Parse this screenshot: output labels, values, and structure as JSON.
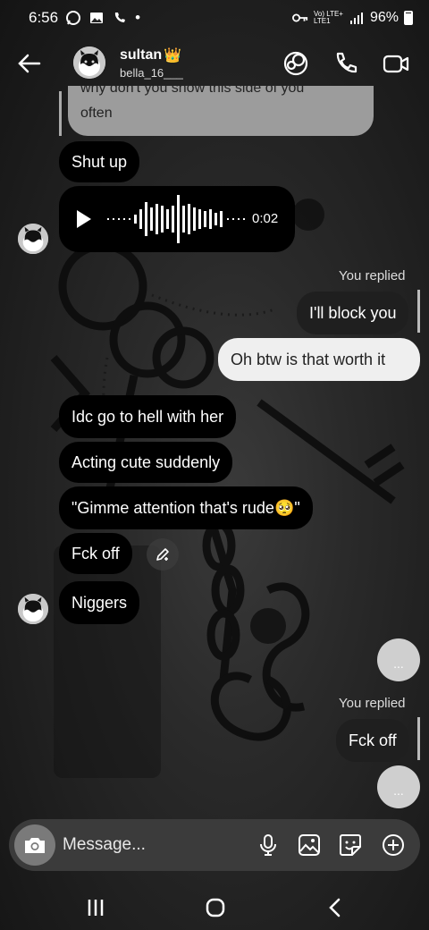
{
  "status_bar": {
    "time": "6:56",
    "lte_top": "Vo) LTE+",
    "lte_bottom": "LTE1",
    "battery": "96%"
  },
  "header": {
    "name": "sultan",
    "name_emoji": "👑",
    "username": "bella_16___"
  },
  "messages": {
    "quoted_line1": "why don't you show this side of you",
    "quoted_line2": "often",
    "m1": "Shut up",
    "voice_duration": "0:02",
    "replied_label_1": "You replied",
    "m_block": "I'll block you",
    "m_btw": "Oh btw is that worth it",
    "m_idc": "Idc go to hell with her",
    "m_acting": "Acting cute suddenly",
    "m_gimme": "\"Gimme attention that's rude",
    "m_gimme_emoji": "🥺",
    "m_gimme_end": "\"",
    "m_fck": "Fck off",
    "m_n": "Niggers",
    "typing_dots": "...",
    "replied_label_2": "You replied",
    "m_fck_reply": "Fck off"
  },
  "composer": {
    "placeholder": "Message..."
  },
  "colors": {
    "received_bubble": "#000000",
    "sent_light_bubble": "#efefef",
    "sent_dark_bubble": "#1f1f1f",
    "quoted_bubble": "#9c9c9c",
    "composer_bg": "#3b3b3b"
  },
  "icons": {
    "back": "arrow-left-icon",
    "theme": "sticker-theme-icon",
    "call": "phone-icon",
    "video": "video-camera-icon",
    "camera": "camera-icon",
    "mic": "microphone-icon",
    "gallery": "image-icon",
    "sticker": "sticker-icon",
    "plus": "plus-circle-icon",
    "edit": "pencil-icon"
  }
}
